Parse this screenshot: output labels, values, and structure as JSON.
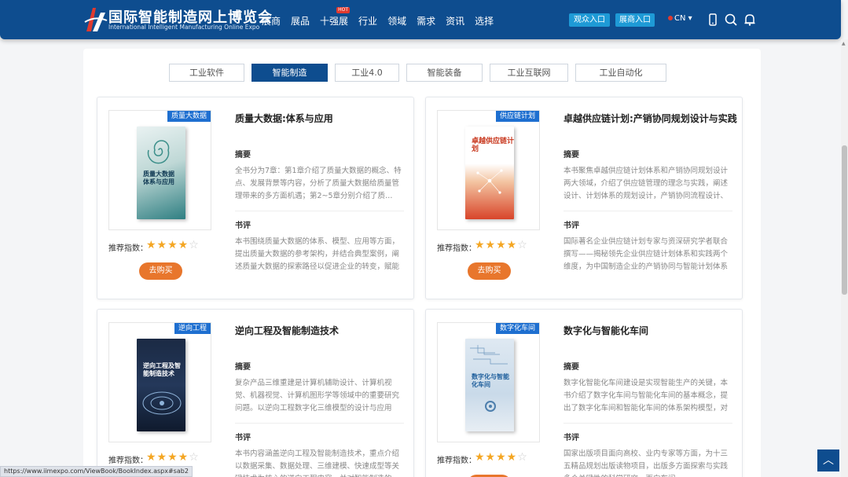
{
  "header": {
    "logo_cn": "国际智能制造网上博览会",
    "logo_en": "International Intelligent Manufacturing Online Expo",
    "nav": [
      "展商",
      "展品",
      "十强展",
      "行业",
      "领域",
      "需求",
      "资讯",
      "选择"
    ],
    "exhibitor_login": "观众入口",
    "visitor_login": "展商入口",
    "language": "CN",
    "icons": [
      "phone-icon",
      "search-icon",
      "bell-icon"
    ]
  },
  "tabs": [
    "工业软件",
    "智能制造",
    "工业4.0",
    "智能装备",
    "工业互联网",
    "工业自动化"
  ],
  "active_tab_index": 1,
  "labels": {
    "abstract": "摘要",
    "review": "书评",
    "recommend": "推荐指数：",
    "buy": "去购买"
  },
  "books": [
    {
      "tag": "质量大数据",
      "title": "质量大数据:体系与应用",
      "cover_text": "质量大数据 体系与应用",
      "abstract": "全书分为7章：第1章介绍了质量大数据的概念、特点、发展背景等内容，分析了质量大数据给质量管理带来的多方面机遇；第2~5章分别介绍了质…",
      "review": "本书围绕质量大数据的体系、模型、应用等方面，提出质量大数据的参考架构，并结合典型案例，阐述质量大数据的探索路径以促进企业的转变，赋能制造业快…",
      "rating": 4
    },
    {
      "tag": "供应链计划",
      "title": "卓越供应链计划:产销协同规划设计与实践",
      "cover_text": "卓越供应链计划",
      "abstract": "本书聚焦卓越供应链计划体系和产销协同规划设计两大领域，介绍了供应链管理的理念与实践，阐述设计、计划体系的规划设计，产销协同流程设计、紫…",
      "review": "国际著名企业供应链计划专家与资深研究学者联合撰写——揭秘领先企业供应链计划体系和实践两个维度，为中国制造企业的产销协同与智能计划体系的方法论…",
      "rating": 4
    },
    {
      "tag": "逆向工程",
      "title": "逆向工程及智能制造技术",
      "cover_text": "逆向工程及智能制造技术",
      "abstract": "复杂产品三维重建是计算机辅助设计、计算机视觉、机器视觉、计算机图形学等领域中的重要研究问题。以逆向工程数字化三维模型的设计与应用为…",
      "review": "本书内容涵盖逆向工程及智能制造技术，重点介绍以数据采集、数据处理、三维建模、快速成型等关键技术为核心的逆向工程内容，并对智能制造的…",
      "rating": 4
    },
    {
      "tag": "数字化车间",
      "title": "数字化与智能化车间",
      "cover_text": "数字化与智能化车间",
      "abstract": "数字化智能化车间建设是实现智能生产的关键，本书介绍了数字化车间与智能化车间的基本概念，提出了数字化车间和智能化车间的体系架构模型，对数字化智能化…",
      "review": "国家出版项目面向高校、业内专家等方面，为十三五精品规划出版读物项目，出版多方面探索与实践多个关键性的科学研究，面向车间…",
      "rating": 4
    }
  ],
  "status_url": "https://www.iimexpo.com/ViewBook/BookIndex.aspx#sab2"
}
